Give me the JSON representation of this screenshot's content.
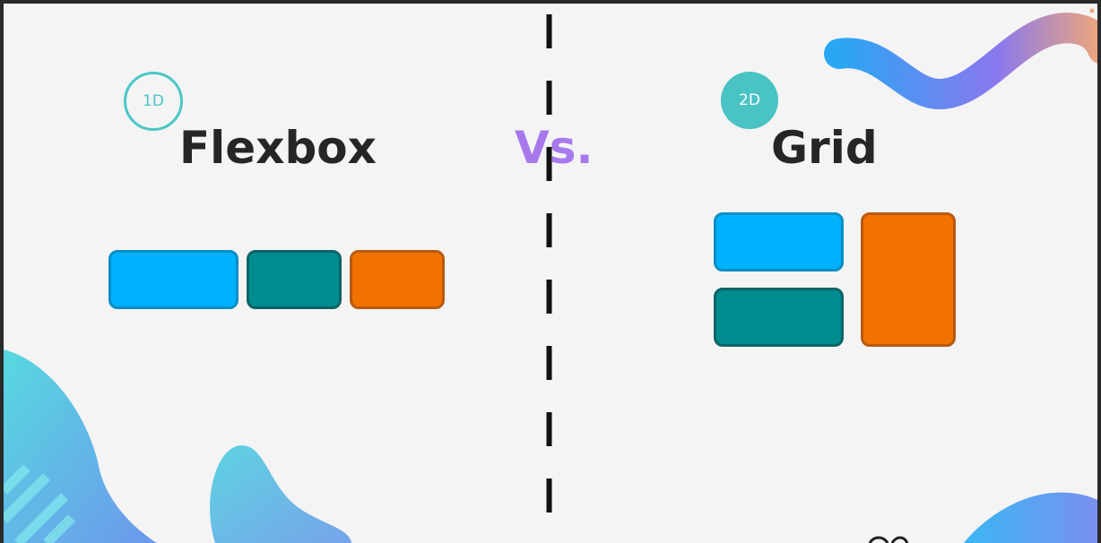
{
  "slide": {
    "flexbox": {
      "badge": "1D",
      "title": "Flexbox"
    },
    "versus": "Vs.",
    "grid": {
      "badge": "2D",
      "title": "Grid"
    }
  },
  "colors": {
    "background": "#f4f4f4",
    "title": "#262626",
    "vs": "#a879ec",
    "badge_teal": "#4cc6c6",
    "box_blue": "#00b1fd",
    "box_teal": "#008b8e",
    "box_orange": "#f27200"
  }
}
